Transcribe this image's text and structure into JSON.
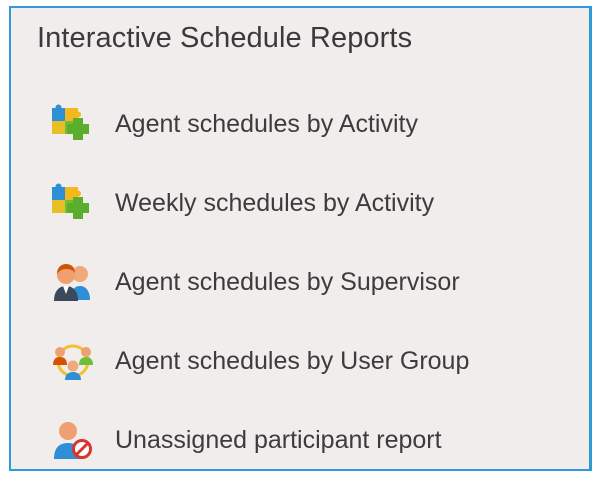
{
  "panel": {
    "title": "Interactive Schedule Reports",
    "accent_color": "#2f9ad6",
    "background_color": "#f1eded"
  },
  "reports": [
    {
      "label": "Agent schedules by Activity",
      "icon": "puzzle-activity-icon"
    },
    {
      "label": "Weekly schedules by Activity",
      "icon": "puzzle-activity-icon"
    },
    {
      "label": "Agent schedules by Supervisor",
      "icon": "supervisor-people-icon"
    },
    {
      "label": "Agent schedules by User Group",
      "icon": "user-group-icon"
    },
    {
      "label": "Unassigned participant report",
      "icon": "unassigned-person-icon"
    }
  ]
}
